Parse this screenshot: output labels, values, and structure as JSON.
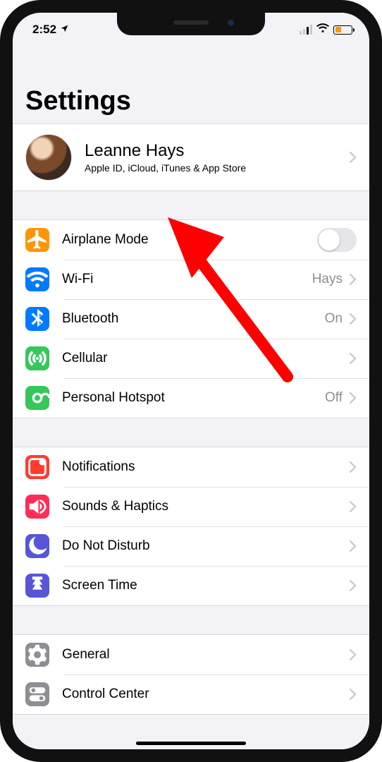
{
  "statusbar": {
    "time": "2:52",
    "battery_level_percent": 35
  },
  "page": {
    "title": "Settings"
  },
  "profile": {
    "name": "Leanne Hays",
    "subtitle": "Apple ID, iCloud, iTunes & App Store"
  },
  "groups": [
    {
      "rows": [
        {
          "icon": "airplane",
          "color": "#ff9500",
          "label": "Airplane Mode",
          "accessory": "switch",
          "switch_on": false
        },
        {
          "icon": "wifi",
          "color": "#007aff",
          "label": "Wi-Fi",
          "accessory": "disclosure",
          "value": "Hays"
        },
        {
          "icon": "bluetooth",
          "color": "#007aff",
          "label": "Bluetooth",
          "accessory": "disclosure",
          "value": "On"
        },
        {
          "icon": "cellular",
          "color": "#34c759",
          "label": "Cellular",
          "accessory": "disclosure"
        },
        {
          "icon": "hotspot",
          "color": "#34c759",
          "label": "Personal Hotspot",
          "accessory": "disclosure",
          "value": "Off"
        }
      ]
    },
    {
      "rows": [
        {
          "icon": "notifications",
          "color": "#ff3b30",
          "label": "Notifications",
          "accessory": "disclosure"
        },
        {
          "icon": "sounds",
          "color": "#ff2d55",
          "label": "Sounds & Haptics",
          "accessory": "disclosure"
        },
        {
          "icon": "dnd",
          "color": "#5856d6",
          "label": "Do Not Disturb",
          "accessory": "disclosure"
        },
        {
          "icon": "screentime",
          "color": "#5856d6",
          "label": "Screen Time",
          "accessory": "disclosure"
        }
      ]
    },
    {
      "rows": [
        {
          "icon": "general",
          "color": "#8e8e93",
          "label": "General",
          "accessory": "disclosure"
        },
        {
          "icon": "control",
          "color": "#8e8e93",
          "label": "Control Center",
          "accessory": "disclosure"
        }
      ]
    }
  ],
  "annotation": {
    "arrow": {
      "color": "#ff0000",
      "hint": "points-to-profile-row"
    }
  }
}
